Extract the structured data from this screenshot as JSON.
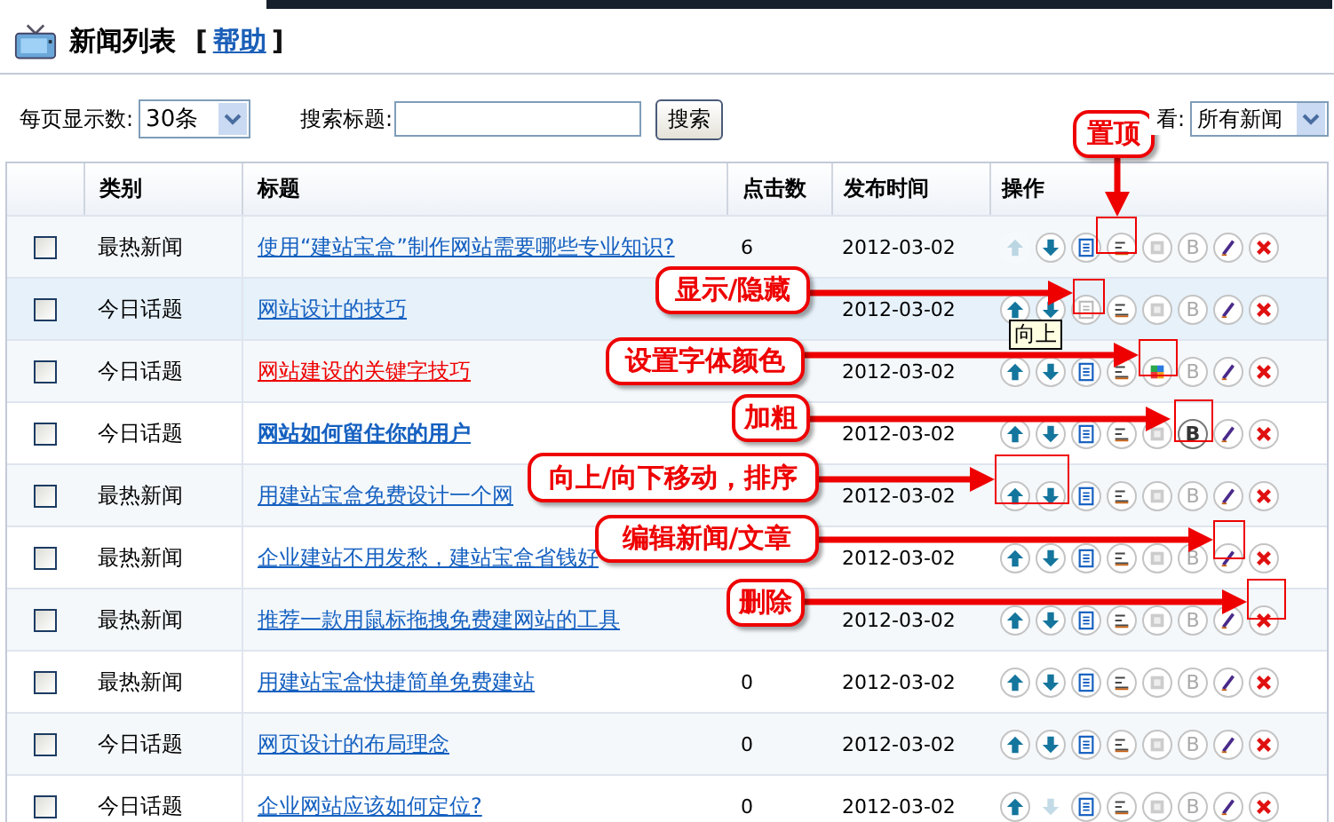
{
  "header": {
    "title": "新闻列表",
    "bracket_open": "[",
    "help_link": "帮助",
    "bracket_close": "]"
  },
  "toolbar": {
    "page_size_label": "每页显示数:",
    "page_size": "30条",
    "search_label": "搜索标题:",
    "search_button": "搜索",
    "filter_label": "看:",
    "filter": "所有新闻"
  },
  "table": {
    "columns": [
      "类别",
      "标题",
      "点击数",
      "发布时间",
      "操作"
    ],
    "rows": [
      {
        "checked": false,
        "hover": false,
        "category": "最热新闻",
        "title": "使用“建站宝盒”制作网站需要哪些专业知识?",
        "clicks": "6",
        "date": "2012-03-02",
        "up_enabled": false,
        "down_enabled": true,
        "visible": true,
        "colored": false,
        "bold": false,
        "bold_label": "B"
      },
      {
        "checked": false,
        "hover": true,
        "category": "今日话题",
        "title": "网站设计的技巧",
        "date": "2012-03-02",
        "up_enabled": true,
        "down_enabled": true,
        "visible": false,
        "colored": false,
        "bold": false,
        "bold_label": "B"
      },
      {
        "checked": false,
        "hover": false,
        "category": "今日话题",
        "title": "网站建设的关键字技巧",
        "date": "2012-03-02",
        "up_enabled": true,
        "down_enabled": true,
        "visible": true,
        "colored": true,
        "bold": false,
        "bold_label": "B"
      },
      {
        "checked": false,
        "hover": false,
        "category": "今日话题",
        "title": "网站如何留住你的用户",
        "date": "2012-03-02",
        "up_enabled": true,
        "down_enabled": true,
        "visible": true,
        "colored": false,
        "bold": true,
        "bold_label": "B"
      },
      {
        "checked": false,
        "hover": false,
        "category": "最热新闻",
        "title": "用建站宝盒免费设计一个网",
        "date": "2012-03-02",
        "up_enabled": true,
        "down_enabled": true,
        "visible": true,
        "colored": false,
        "bold": false,
        "bold_label": "B"
      },
      {
        "checked": false,
        "hover": false,
        "category": "最热新闻",
        "title": "企业建站不用发愁，建站宝盒省钱好",
        "date": "2012-03-02",
        "up_enabled": true,
        "down_enabled": true,
        "visible": true,
        "colored": false,
        "bold": false,
        "bold_label": "B"
      },
      {
        "checked": false,
        "hover": false,
        "category": "最热新闻",
        "title": "推荐一款用鼠标拖拽免费建网站的工具",
        "date": "2012-03-02",
        "up_enabled": true,
        "down_enabled": true,
        "visible": true,
        "colored": false,
        "bold": false,
        "bold_label": "B"
      },
      {
        "checked": false,
        "hover": false,
        "category": "最热新闻",
        "title": "用建站宝盒快捷简单免费建站",
        "clicks": "0",
        "date": "2012-03-02",
        "up_enabled": true,
        "down_enabled": true,
        "visible": true,
        "colored": false,
        "bold": false,
        "bold_label": "B"
      },
      {
        "checked": false,
        "hover": false,
        "category": "今日话题",
        "title": "网页设计的布局理念",
        "clicks": "0",
        "date": "2012-03-02",
        "up_enabled": true,
        "down_enabled": true,
        "visible": true,
        "colored": false,
        "bold": false,
        "bold_label": "B"
      },
      {
        "checked": false,
        "hover": false,
        "category": "今日话题",
        "title": "企业网站应该如何定位?",
        "clicks": "0",
        "date": "2012-03-02",
        "up_enabled": true,
        "down_enabled": false,
        "visible": true,
        "colored": false,
        "bold": false,
        "bold_label": "B"
      }
    ]
  },
  "tooltip": "向上",
  "callouts": [
    {
      "text": "置顶"
    },
    {
      "text": "显示/隐藏"
    },
    {
      "text": "设置字体颜色"
    },
    {
      "text": "加粗"
    },
    {
      "text": "向上/向下移动，排序"
    },
    {
      "text": "编辑新闻/文章"
    },
    {
      "text": "删除"
    }
  ]
}
